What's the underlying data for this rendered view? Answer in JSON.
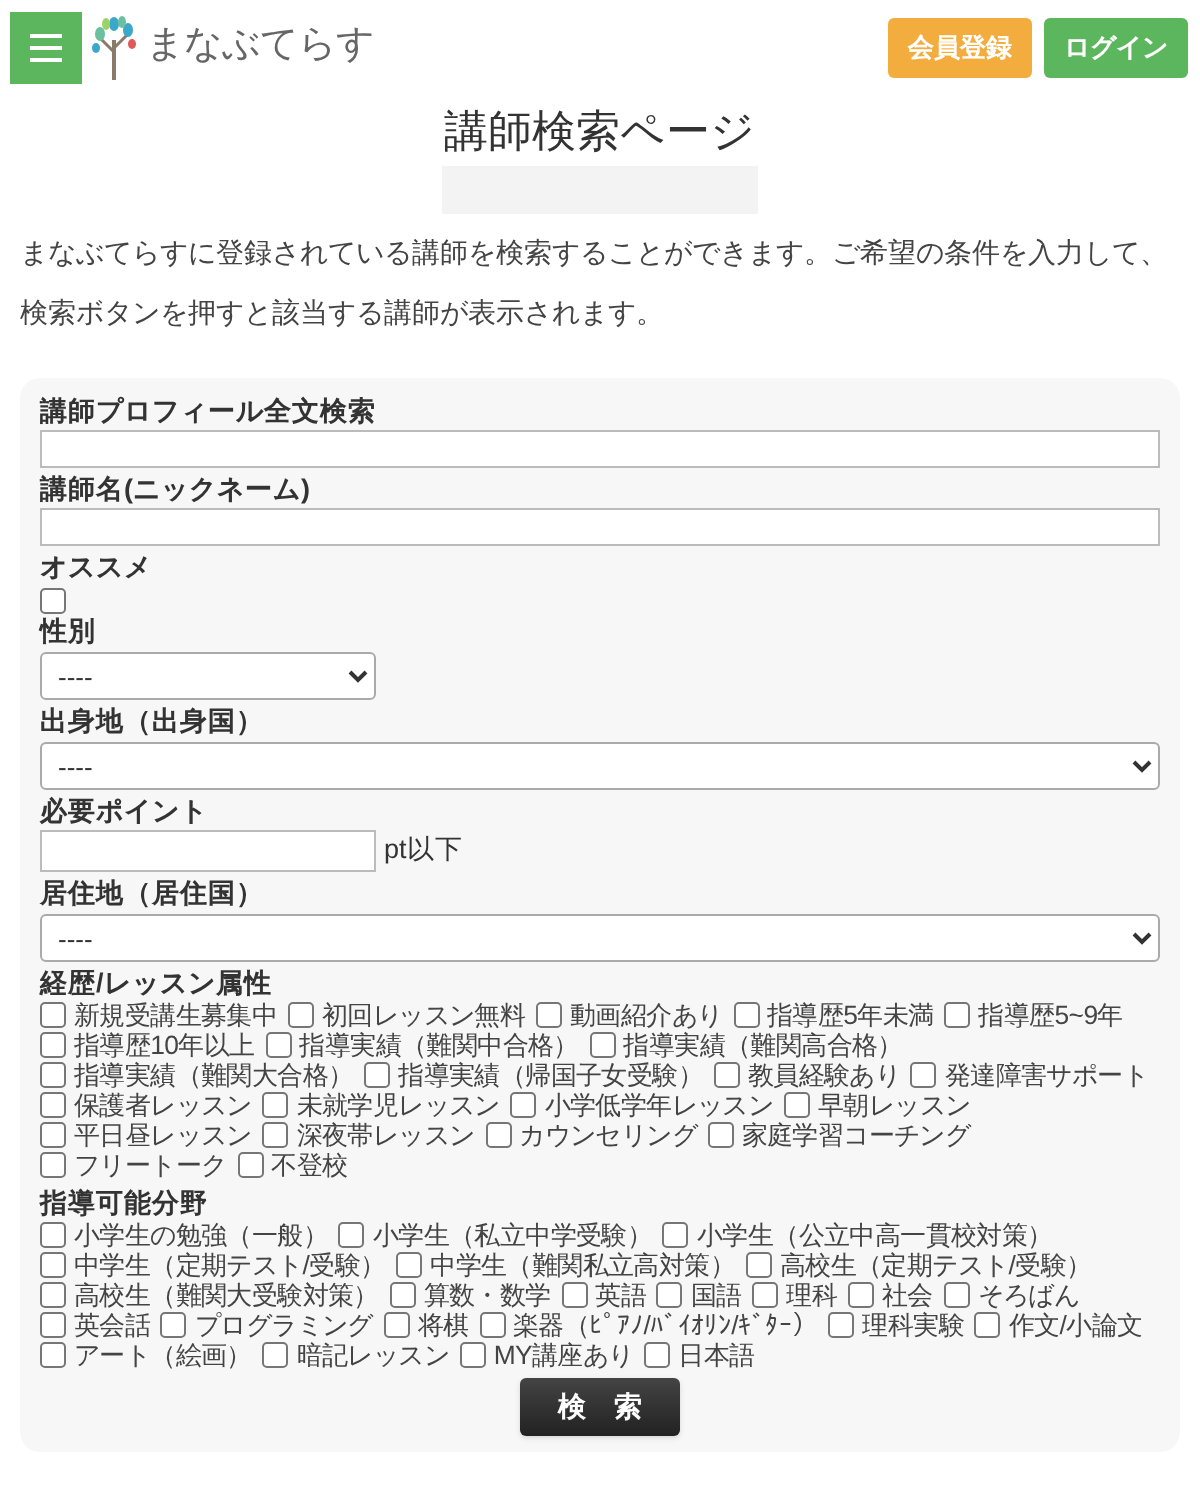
{
  "header": {
    "logo": "まなぶてらす",
    "buttons": [
      {
        "label": "会員登録",
        "kind": "register"
      },
      {
        "label": "ログイン",
        "kind": "login"
      }
    ]
  },
  "title": "講師検索ページ",
  "intro": "まなぶてらすに登録されている講師を検索することができます。ご希望の条件を入力して、検索ボタンを押すと該当する講師が表示されます。",
  "form": {
    "fields": [
      {
        "kind": "text",
        "label": "講師プロフィール全文検索"
      },
      {
        "kind": "text",
        "label": "講師名(ニックネーム)"
      },
      {
        "kind": "checkbox",
        "label": "オススメ",
        "checked": false
      },
      {
        "kind": "select-short",
        "label": "性別",
        "value": "----"
      },
      {
        "kind": "select",
        "label": "出身地（出身国）",
        "value": "----"
      },
      {
        "kind": "points",
        "label": "必要ポイント",
        "suffix": "pt以下"
      },
      {
        "kind": "select",
        "label": "居住地（居住国）",
        "value": "----"
      },
      {
        "kind": "checkgroup",
        "label": "経歴/レッスン属性",
        "options": [
          {
            "label": "新規受講生募集中",
            "checked": false
          },
          {
            "label": "初回レッスン無料",
            "checked": false
          },
          {
            "label": "動画紹介あり",
            "checked": false
          },
          {
            "label": "指導歴5年未満",
            "checked": false
          },
          {
            "label": "指導歴5~9年",
            "checked": false
          },
          {
            "label": "指導歴10年以上",
            "checked": false
          },
          {
            "label": "指導実績（難関中合格）",
            "checked": false
          },
          {
            "label": "指導実績（難関高合格）",
            "checked": false
          },
          {
            "label": "指導実績（難関大合格）",
            "checked": false
          },
          {
            "label": "指導実績（帰国子女受験）",
            "checked": false
          },
          {
            "label": "教員経験あり",
            "checked": false
          },
          {
            "label": "発達障害サポート",
            "checked": false
          },
          {
            "label": "保護者レッスン",
            "checked": false
          },
          {
            "label": "未就学児レッスン",
            "checked": false
          },
          {
            "label": "小学低学年レッスン",
            "checked": false
          },
          {
            "label": "早朝レッスン",
            "checked": false
          },
          {
            "label": "平日昼レッスン",
            "checked": false
          },
          {
            "label": "深夜帯レッスン",
            "checked": false
          },
          {
            "label": "カウンセリング",
            "checked": false
          },
          {
            "label": "家庭学習コーチング",
            "checked": false
          },
          {
            "label": "フリートーク",
            "checked": false
          },
          {
            "label": "不登校",
            "checked": false
          }
        ]
      },
      {
        "kind": "checkgroup",
        "label": "指導可能分野",
        "options": [
          {
            "label": "小学生の勉強（一般）",
            "checked": false
          },
          {
            "label": "小学生（私立中学受験）",
            "checked": false
          },
          {
            "label": "小学生（公立中高一貫校対策）",
            "checked": false
          },
          {
            "label": "中学生（定期テスト/受験）",
            "checked": false
          },
          {
            "label": "中学生（難関私立高対策）",
            "checked": false
          },
          {
            "label": "高校生（定期テスト/受験）",
            "checked": false
          },
          {
            "label": "高校生（難関大受験対策）",
            "checked": false
          },
          {
            "label": "算数・数学",
            "checked": false
          },
          {
            "label": "英語",
            "checked": false
          },
          {
            "label": "国語",
            "checked": false
          },
          {
            "label": "理科",
            "checked": false
          },
          {
            "label": "社会",
            "checked": false
          },
          {
            "label": "そろばん",
            "checked": false
          },
          {
            "label": "英会話",
            "checked": false
          },
          {
            "label": "プログラミング",
            "checked": false
          },
          {
            "label": "将棋",
            "checked": false
          },
          {
            "label": "楽器（ﾋﾟｱﾉ/ﾊﾞｲｵﾘﾝ/ｷﾞﾀｰ）",
            "checked": false
          },
          {
            "label": "理科実験",
            "checked": false
          },
          {
            "label": "作文/小論文",
            "checked": false
          },
          {
            "label": "アート（絵画）",
            "checked": false
          },
          {
            "label": "暗記レッスン",
            "checked": false
          },
          {
            "label": "MY講座あり",
            "checked": false
          },
          {
            "label": "日本語",
            "checked": false
          }
        ]
      }
    ],
    "submit": "検　索"
  }
}
